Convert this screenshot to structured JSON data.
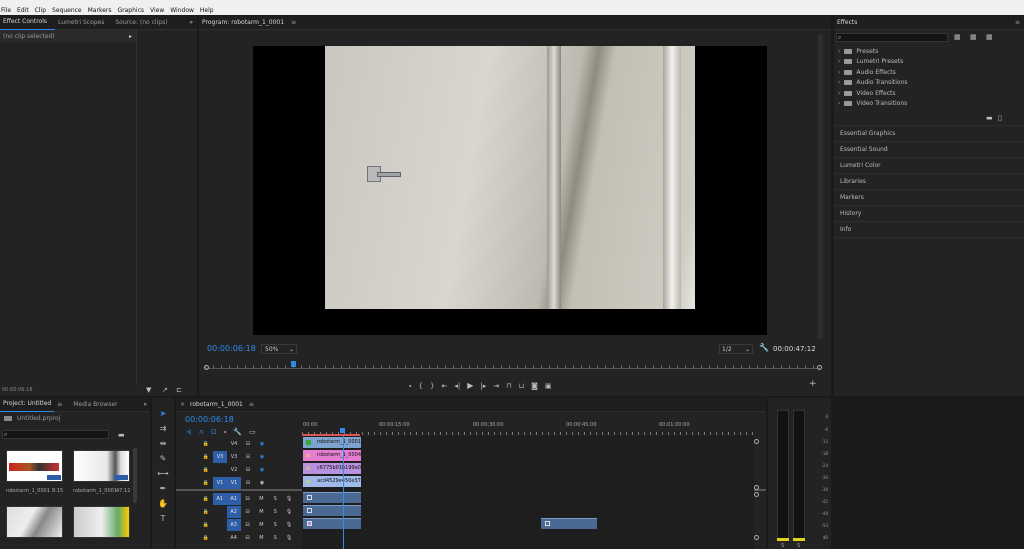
{
  "menu": [
    "File",
    "Edit",
    "Clip",
    "Sequence",
    "Markers",
    "Graphics",
    "View",
    "Window",
    "Help"
  ],
  "source_panel": {
    "tabs": [
      "Effect Controls",
      "Lumetri Scopes",
      "Source: (no clips)"
    ],
    "more": "»",
    "no_clip": "(no clip selected)",
    "timecode": "00:00:06:18"
  },
  "program": {
    "title": "Program: robotarm_1_0001",
    "menu_glyph": "≡",
    "timecode": "00:00:06:18",
    "zoom": "50%",
    "resolution": "1/2",
    "duration": "00:00:47:12",
    "playhead_fraction": 0.143
  },
  "effects_panel": {
    "title": "Effects",
    "menu_glyph": "≡",
    "items": [
      "Presets",
      "Lumetri Presets",
      "Audio Effects",
      "Audio Transitions",
      "Video Effects",
      "Video Transitions"
    ],
    "side_panels": [
      "Essential Graphics",
      "Essential Sound",
      "Lumetri Color",
      "Libraries",
      "Markers",
      "History",
      "Info"
    ]
  },
  "project": {
    "tabs": [
      "Project: Untitled",
      "Media Browser"
    ],
    "menu_glyph": "≡",
    "more": "»",
    "file": "Untitled.prproj",
    "thumbs": [
      {
        "name": "robotarm_1_0001",
        "dur": "8:15"
      },
      {
        "name": "robotarm_1_0001",
        "dur": "47:12"
      }
    ]
  },
  "timeline": {
    "seq_name": "robotarm_1_0001",
    "menu_glyph": "≡",
    "timecode": "00:00:06:18",
    "ruler": [
      "00:00",
      "00:00:15:00",
      "00:00:30:00",
      "00:00:45:00",
      "00:01:00:00"
    ],
    "tracks": [
      {
        "src": "",
        "name": "V4",
        "kind": "video"
      },
      {
        "src": "V3",
        "name": "V3",
        "kind": "video"
      },
      {
        "src": "",
        "name": "V2",
        "kind": "video"
      },
      {
        "src": "V1",
        "name": "V1",
        "kind": "video"
      },
      {
        "src": "A1",
        "name": "A1",
        "kind": "audio"
      },
      {
        "src": "",
        "name": "A2",
        "kind": "audio"
      },
      {
        "src": "",
        "name": "A3",
        "kind": "audio"
      },
      {
        "src": "",
        "name": "A4",
        "kind": "audio"
      }
    ],
    "clips": [
      {
        "label": "robotarm_1_0001",
        "fx": "fx"
      },
      {
        "label": "robotarm_1_0004",
        "fx": "fx"
      },
      {
        "label": "c6775b01b199e0e",
        "fx": "fx"
      },
      {
        "label": "acd4529e450e3707",
        "fx": "fx"
      }
    ],
    "mute_letter": "M",
    "solo_letter": "S"
  },
  "meter": {
    "labels": [
      "0",
      "-6",
      "-12",
      "-18",
      "-24",
      "-30",
      "-36",
      "-42",
      "-48",
      "-54",
      "dB"
    ],
    "bottom": [
      "S",
      "S"
    ]
  }
}
